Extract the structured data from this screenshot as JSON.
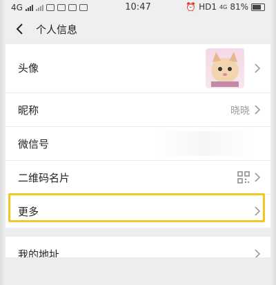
{
  "status_bar": {
    "network": "4G",
    "time": "10:47",
    "hd_label": "HD1",
    "network_small": "4G",
    "battery_percent": "81%"
  },
  "header": {
    "title": "个人信息"
  },
  "rows": {
    "avatar": {
      "label": "头像"
    },
    "nickname": {
      "label": "昵称",
      "value": "晓晓"
    },
    "wechat_id": {
      "label": "微信号"
    },
    "qr_card": {
      "label": "二维码名片"
    },
    "more": {
      "label": "更多"
    },
    "address": {
      "label": "我的地址"
    }
  },
  "colors": {
    "highlight": "#f3c623",
    "page_bg": "#ededed",
    "row_bg": "#ffffff"
  }
}
